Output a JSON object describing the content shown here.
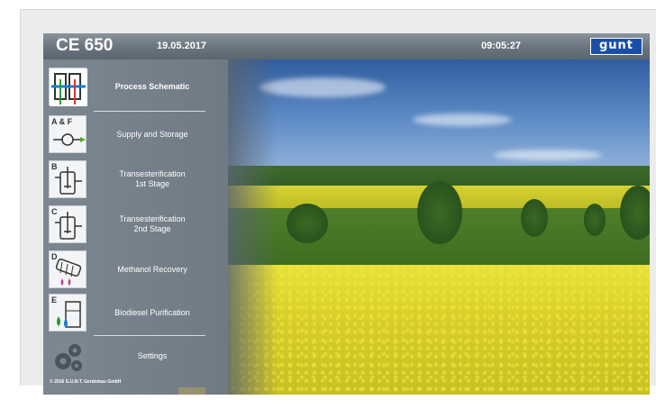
{
  "window": {
    "app_title": "CE 650",
    "date": "19.05.2017",
    "time": "09:05:27",
    "logo_text": "gunt"
  },
  "menu": [
    {
      "label": "Process Schematic",
      "sub": "",
      "icon": "process-schematic-icon",
      "letter": "",
      "active": true
    },
    {
      "label": "Supply and Storage",
      "sub": "",
      "icon": "supply-storage-icon",
      "letter": "A & F",
      "active": false
    },
    {
      "label": "Transesterification",
      "sub": "1st Stage",
      "icon": "transesterification-1-icon",
      "letter": "B",
      "active": false
    },
    {
      "label": "Transesterification",
      "sub": "2nd Stage",
      "icon": "transesterification-2-icon",
      "letter": "C",
      "active": false
    },
    {
      "label": "Methanol Recovery",
      "sub": "",
      "icon": "methanol-recovery-icon",
      "letter": "D",
      "active": false
    },
    {
      "label": "Biodiesel Purification",
      "sub": "",
      "icon": "biodiesel-purification-icon",
      "letter": "E",
      "active": false
    },
    {
      "label": "Settings",
      "sub": "",
      "icon": "gears-icon",
      "letter": "",
      "active": false
    }
  ],
  "footer": {
    "copyright": "© 2016 G.U.N.T. Gerätebau GmbH"
  },
  "colors": {
    "titlebar": "#6c7680",
    "sidebar": "#76818b",
    "logo_bg": "#1a4fa8"
  }
}
